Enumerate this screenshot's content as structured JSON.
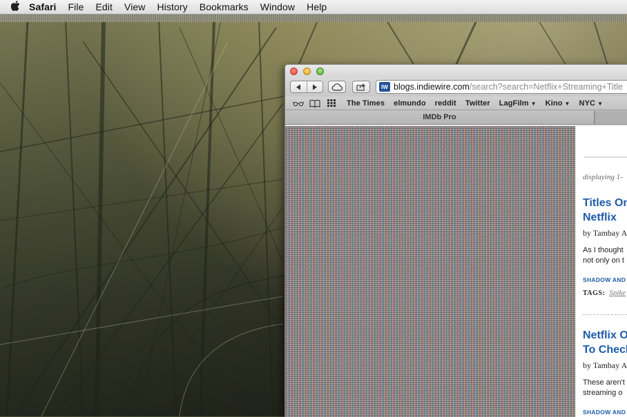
{
  "menubar": {
    "apple_icon": "apple-icon",
    "app_name": "Safari",
    "items": [
      "File",
      "Edit",
      "View",
      "History",
      "Bookmarks",
      "Window",
      "Help"
    ]
  },
  "browser": {
    "toolbar": {
      "back_icon": "back-arrow-icon",
      "forward_icon": "forward-arrow-icon",
      "icloud_icon": "cloud-icon",
      "share_icon": "share-icon",
      "address": {
        "favicon_text": "IW",
        "host": "blogs.indiewire.com",
        "path": "/search?search=Netflix+Streaming+Title"
      }
    },
    "bookmarks_bar": {
      "icons": [
        "reading-list-icon",
        "bookmarks-icon",
        "top-sites-icon"
      ],
      "items": [
        {
          "label": "The Times",
          "folder": false
        },
        {
          "label": "elmundo",
          "folder": false
        },
        {
          "label": "reddit",
          "folder": false
        },
        {
          "label": "Twitter",
          "folder": false
        },
        {
          "label": "LagFilm",
          "folder": true
        },
        {
          "label": "Kino",
          "folder": true
        },
        {
          "label": "NYC",
          "folder": true
        }
      ],
      "folder_caret": "▼"
    },
    "tabs": {
      "active": "IMDb Pro"
    }
  },
  "page": {
    "results_label": "displaying 1-",
    "posts": [
      {
        "title_line1": "Titles On",
        "title_line2": "Netflix",
        "byline": "by Tambay A",
        "excerpt_line1": "As I thought",
        "excerpt_line2": "not only on t",
        "category": "SHADOW AND",
        "tags_label": "TAGS:",
        "tag": "Spike"
      },
      {
        "title_line1": "Netflix O",
        "title_line2": "To Check",
        "byline": "by Tambay A",
        "excerpt_line1": "These aren't",
        "excerpt_line2": "streaming o",
        "category": "SHADOW AND"
      }
    ]
  },
  "colors": {
    "link_blue": "#1d5ba8",
    "favicon_blue": "#21539a"
  }
}
